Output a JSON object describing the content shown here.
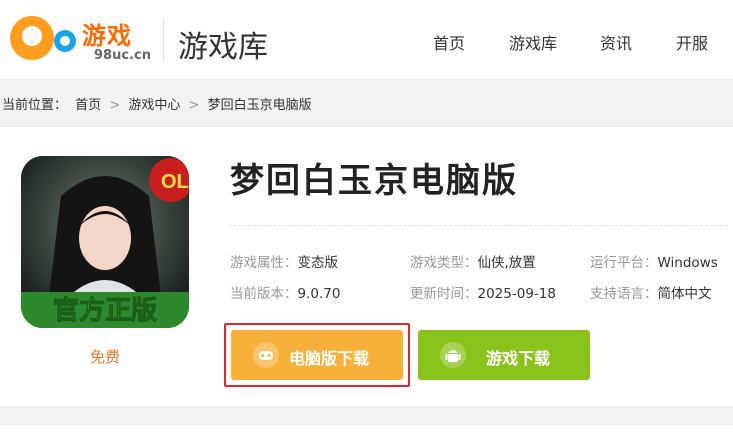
{
  "header": {
    "logo_text": "游戏",
    "logo_sub": "98uc.cn",
    "section_title": "游戏库",
    "nav": [
      "首页",
      "游戏库",
      "资讯",
      "开服"
    ]
  },
  "breadcrumb": {
    "prefix": "当前位置：",
    "items": [
      "首页",
      "游戏中心",
      "梦回白玉京电脑版"
    ],
    "separator": ">"
  },
  "game": {
    "title": "梦回白玉京电脑版",
    "price_label": "免费",
    "icon_badge": "OL",
    "icon_banner": "官方正版",
    "info": [
      {
        "key": "游戏属性：",
        "value": "变态版"
      },
      {
        "key": "游戏类型：",
        "value": "仙侠,放置"
      },
      {
        "key": "运行平台：",
        "value": "Windows"
      },
      {
        "key": "当前版本：",
        "value": "9.0.70"
      },
      {
        "key": "更新时间：",
        "value": "2025-09-18"
      },
      {
        "key": "支持语言：",
        "value": "简体中文"
      }
    ]
  },
  "buttons": {
    "pc_download": "电脑版下载",
    "game_download": "游戏下载"
  },
  "colors": {
    "accent_orange": "#f7b03a",
    "accent_green": "#8ac31c",
    "highlight_red": "#d8292f",
    "price_orange": "#e87a24"
  }
}
